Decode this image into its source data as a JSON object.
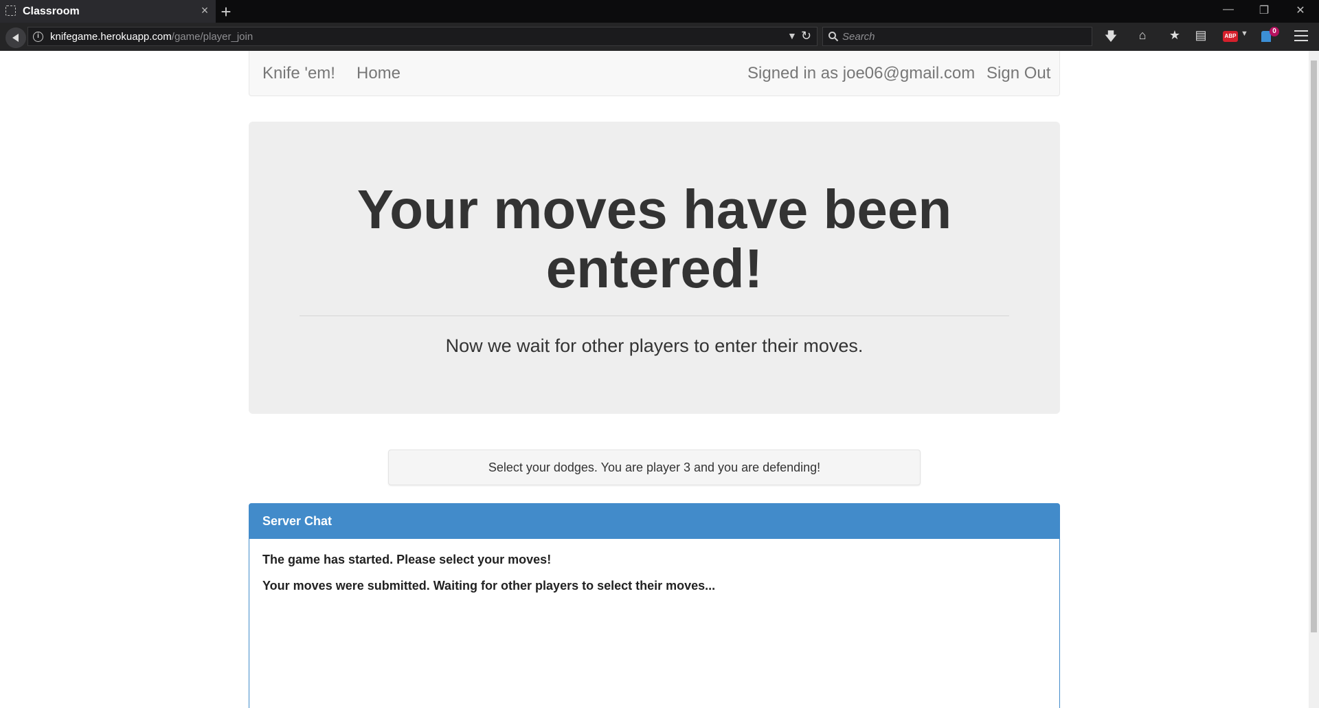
{
  "browser": {
    "tab_title": "Classroom",
    "url_host": "knifegame.herokuapp.com",
    "url_path": "/game/player_join",
    "search_placeholder": "Search",
    "extension_badge": "0",
    "abp_label": "ABP"
  },
  "site_nav": {
    "brand": "Knife 'em!",
    "home": "Home",
    "signed_in": "Signed in as joe06@gmail.com",
    "sign_out": "Sign Out"
  },
  "jumbotron": {
    "title_line1": "Your moves have been",
    "title_line2": "entered!",
    "subtitle": "Now we wait for other players to enter their moves."
  },
  "status": {
    "message": "Select your dodges. You are player 3 and you are defending!"
  },
  "chat": {
    "heading": "Server Chat",
    "messages": [
      "The game has started. Please select your moves!",
      "Your moves were submitted. Waiting for other players to select their moves..."
    ]
  },
  "colors": {
    "panel_primary": "#428bca",
    "jumbotron_bg": "#eeeeee",
    "abp_red": "#d6202c",
    "badge_magenta": "#b5125f"
  }
}
